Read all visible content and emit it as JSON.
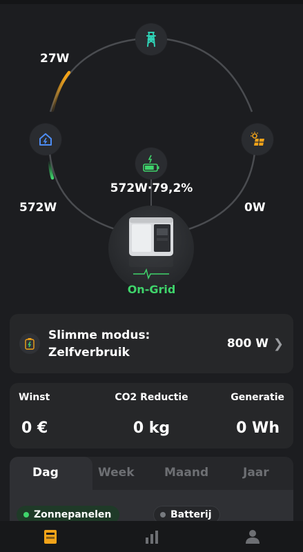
{
  "flow": {
    "grid_power": "27W",
    "home_power": "572W",
    "solar_power": "0W",
    "battery_status": "572W·79,2%",
    "battery_level": 0.792,
    "status": "On-Grid"
  },
  "mode": {
    "title_line1": "Slimme modus:",
    "title_line2": "Zelfverbruik",
    "power": "800 W"
  },
  "stats": {
    "profit_label": "Winst",
    "profit_value": "0 €",
    "co2_label": "CO2 Reductie",
    "co2_value": "0 kg",
    "generation_label": "Generatie",
    "generation_value": "0 Wh"
  },
  "tabs": [
    {
      "label": "Dag",
      "active": true
    },
    {
      "label": "Week",
      "active": false
    },
    {
      "label": "Maand",
      "active": false
    },
    {
      "label": "Jaar",
      "active": false
    }
  ],
  "legend": [
    {
      "label": "Zonnepanelen",
      "color": "#3fd46b",
      "selected": true
    },
    {
      "label": "Batterij",
      "color": "#777a7f",
      "selected": false
    }
  ],
  "nav": [
    {
      "icon": "device-icon",
      "active": true
    },
    {
      "icon": "stats-icon",
      "active": false
    },
    {
      "icon": "profile-icon",
      "active": false
    }
  ],
  "colors": {
    "accent_green": "#3fd46b",
    "accent_orange": "#f2a319",
    "grid_teal": "#2fd1b5",
    "home_blue": "#4d8df5"
  }
}
